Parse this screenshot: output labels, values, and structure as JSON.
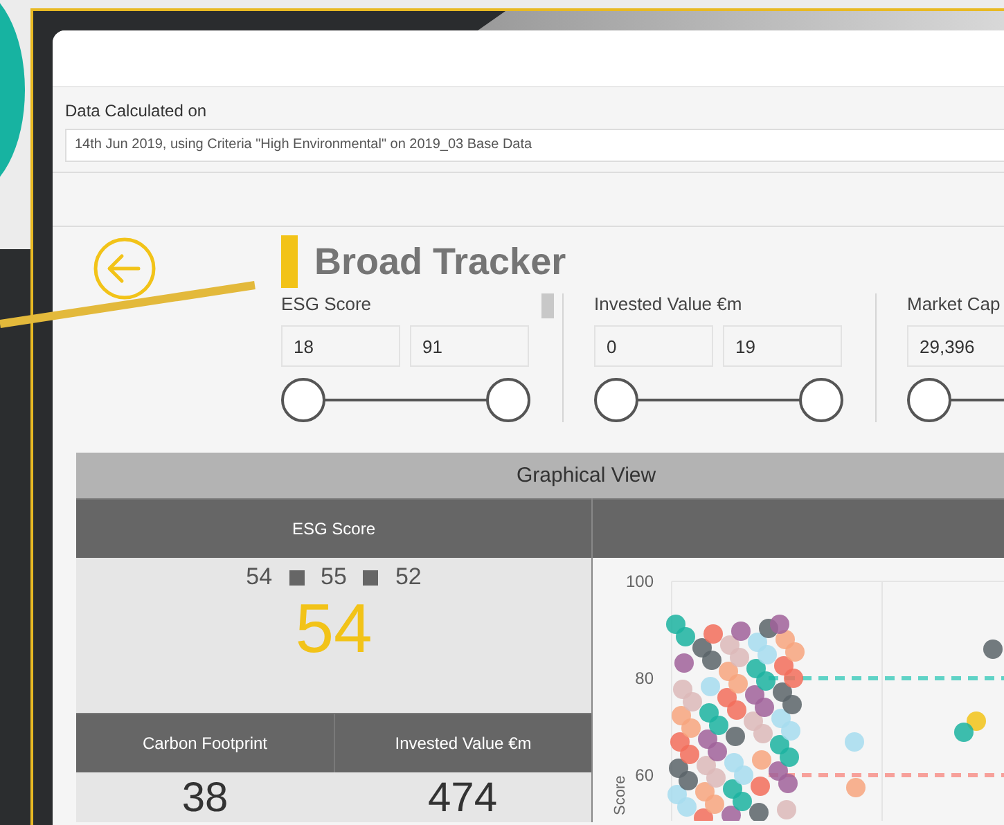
{
  "data_calculated": {
    "label": "Data Calculated on",
    "value": "14th Jun 2019, using Criteria \"High Environmental\" on 2019_03 Base Data"
  },
  "title": "Broad Tracker",
  "filters": [
    {
      "label": "ESG Score",
      "min": "18",
      "max": "91",
      "thumbs": [
        {
          "level": 0
        },
        {
          "level": 1
        }
      ]
    },
    {
      "label": "Invested Value €m",
      "min": "0",
      "max": "19",
      "thumbs": [
        {
          "level": 0
        },
        {
          "level": 1
        }
      ]
    },
    {
      "label": "Market Cap",
      "min": "29,396",
      "thumbs": [
        {
          "level": 0
        }
      ]
    }
  ],
  "graphical_view": {
    "title": "Graphical View",
    "esg_panel": {
      "header": "ESG Score",
      "breakdown": [
        "54",
        "55",
        "52"
      ],
      "value": "54"
    },
    "metrics": [
      {
        "header": "Carbon Footprint",
        "value": "38"
      },
      {
        "header": "Invested Value €m",
        "value": "474"
      }
    ],
    "chart": {
      "y_ticks": [
        "100",
        "80",
        "60"
      ],
      "y_label": "Score"
    }
  }
}
